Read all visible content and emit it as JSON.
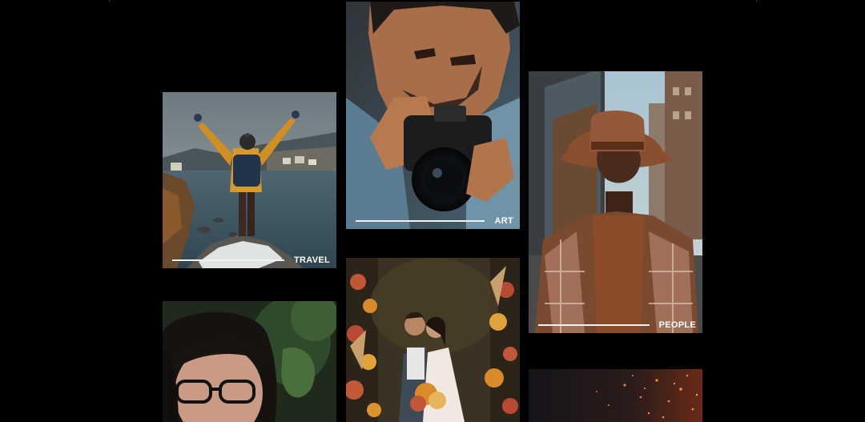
{
  "gallery": {
    "tiles": [
      {
        "id": "travel",
        "label": "TRAVEL",
        "subject": "hiker with arms raised over a fjord village"
      },
      {
        "id": "art",
        "label": "ART",
        "subject": "photographer aiming a camera"
      },
      {
        "id": "people",
        "label": "PEOPLE",
        "subject": "man in a brown hat and plaid coat on a street"
      },
      {
        "id": "portrait",
        "label": "",
        "subject": "smiling woman with glasses"
      },
      {
        "id": "wedding",
        "label": "",
        "subject": "couple embracing among flowers"
      },
      {
        "id": "sparks",
        "label": "",
        "subject": "glowing sparks on a dark background"
      }
    ]
  },
  "colors": {
    "background": "#000000",
    "caption_text": "#ffffff",
    "caption_line": "#f2f2f2"
  }
}
